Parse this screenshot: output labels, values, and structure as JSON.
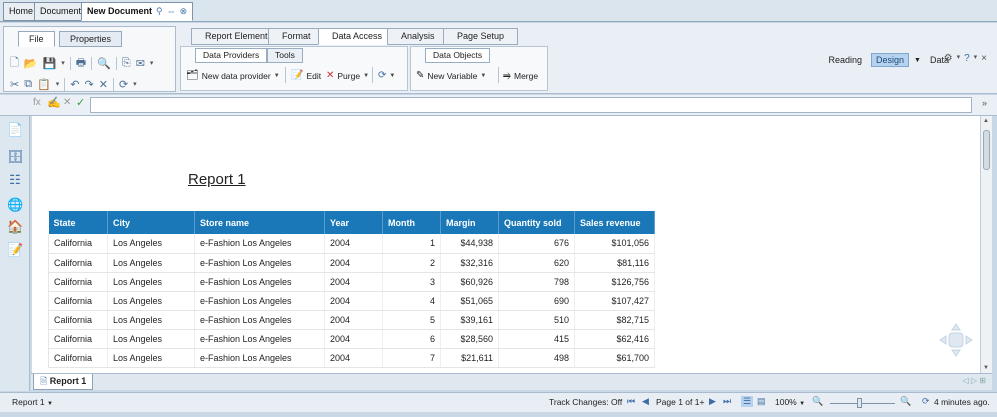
{
  "doc_tabs": [
    "Home",
    "Documents",
    "New Document"
  ],
  "ribbon": {
    "left_tabs": [
      "File",
      "Properties"
    ],
    "main_tabs": [
      "Report Element",
      "Format",
      "Data Access",
      "Analysis",
      "Page Setup"
    ],
    "sub_tabs": [
      "Data Providers",
      "Tools"
    ],
    "data_objects_tab": "Data Objects",
    "commands": {
      "new_data_provider": "New data provider",
      "edit": "Edit",
      "purge": "Purge",
      "new_variable": "New Variable",
      "merge": "Merge"
    },
    "view_modes": [
      "Reading",
      "Design",
      "Data"
    ]
  },
  "report": {
    "title": "Report 1",
    "columns": [
      "State",
      "City",
      "Store name",
      "Year",
      "Month",
      "Margin",
      "Quantity sold",
      "Sales revenue"
    ],
    "rows": [
      [
        "California",
        "Los Angeles",
        "e-Fashion Los Angeles",
        "2004",
        "1",
        "$44,938",
        "676",
        "$101,056"
      ],
      [
        "California",
        "Los Angeles",
        "e-Fashion Los Angeles",
        "2004",
        "2",
        "$32,316",
        "620",
        "$81,116"
      ],
      [
        "California",
        "Los Angeles",
        "e-Fashion Los Angeles",
        "2004",
        "3",
        "$60,926",
        "798",
        "$126,756"
      ],
      [
        "California",
        "Los Angeles",
        "e-Fashion Los Angeles",
        "2004",
        "4",
        "$51,065",
        "690",
        "$107,427"
      ],
      [
        "California",
        "Los Angeles",
        "e-Fashion Los Angeles",
        "2004",
        "5",
        "$39,161",
        "510",
        "$82,715"
      ],
      [
        "California",
        "Los Angeles",
        "e-Fashion Los Angeles",
        "2004",
        "6",
        "$28,560",
        "415",
        "$62,416"
      ],
      [
        "California",
        "Los Angeles",
        "e-Fashion Los Angeles",
        "2004",
        "7",
        "$21,611",
        "498",
        "$61,700"
      ]
    ]
  },
  "report_tab": "Report 1",
  "status": {
    "report_selector": "Report 1",
    "track_changes": "Track Changes: Off",
    "page": "Page 1 of 1+",
    "zoom": "100%",
    "refreshed": "4 minutes ago."
  },
  "colors": {
    "header_blue": "#1a78b8",
    "ribbon_bg": "#e9eff5",
    "accent": "#3d6da2"
  }
}
